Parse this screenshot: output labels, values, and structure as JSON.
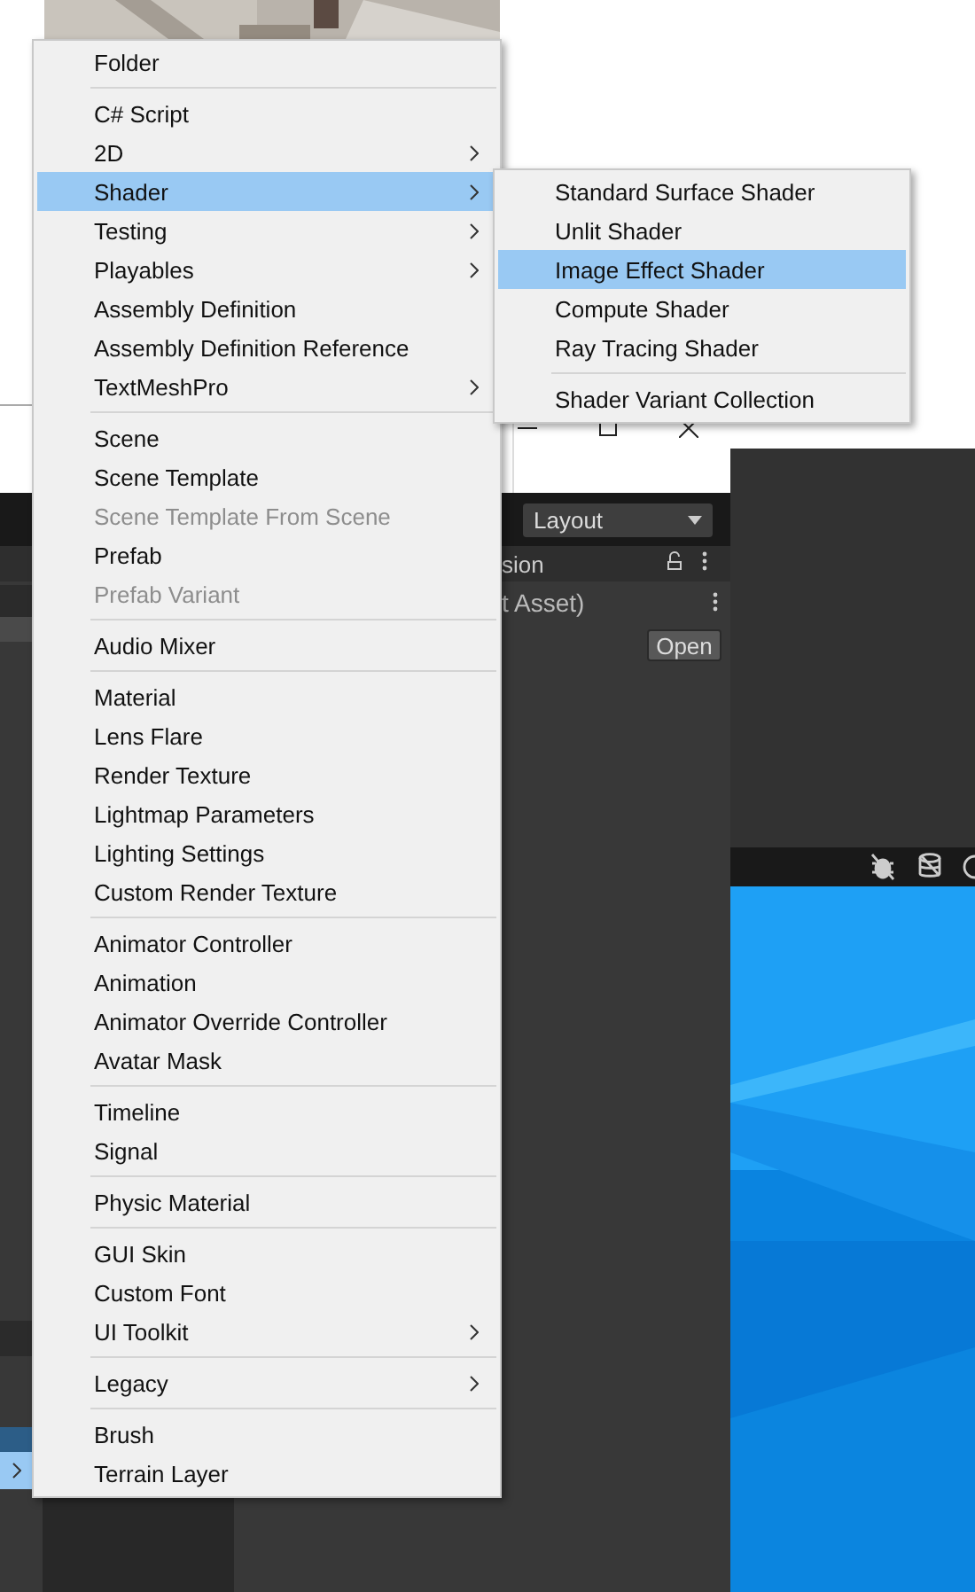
{
  "editor": {
    "layout_dropdown": {
      "label": "Layout"
    },
    "inspector": {
      "title": "sion",
      "asset_name": "t Asset)",
      "open_button": "Open"
    }
  },
  "menu": {
    "items": [
      {
        "kind": "item",
        "label": "Folder",
        "submenu": false,
        "disabled": false,
        "selected": false
      },
      {
        "kind": "separator"
      },
      {
        "kind": "item",
        "label": "C# Script",
        "submenu": false,
        "disabled": false,
        "selected": false
      },
      {
        "kind": "item",
        "label": "2D",
        "submenu": true,
        "disabled": false,
        "selected": false
      },
      {
        "kind": "item",
        "label": "Shader",
        "submenu": true,
        "disabled": false,
        "selected": true
      },
      {
        "kind": "item",
        "label": "Testing",
        "submenu": true,
        "disabled": false,
        "selected": false
      },
      {
        "kind": "item",
        "label": "Playables",
        "submenu": true,
        "disabled": false,
        "selected": false
      },
      {
        "kind": "item",
        "label": "Assembly Definition",
        "submenu": false,
        "disabled": false,
        "selected": false
      },
      {
        "kind": "item",
        "label": "Assembly Definition Reference",
        "submenu": false,
        "disabled": false,
        "selected": false
      },
      {
        "kind": "item",
        "label": "TextMeshPro",
        "submenu": true,
        "disabled": false,
        "selected": false
      },
      {
        "kind": "separator"
      },
      {
        "kind": "item",
        "label": "Scene",
        "submenu": false,
        "disabled": false,
        "selected": false
      },
      {
        "kind": "item",
        "label": "Scene Template",
        "submenu": false,
        "disabled": false,
        "selected": false
      },
      {
        "kind": "item",
        "label": "Scene Template From Scene",
        "submenu": false,
        "disabled": true,
        "selected": false
      },
      {
        "kind": "item",
        "label": "Prefab",
        "submenu": false,
        "disabled": false,
        "selected": false
      },
      {
        "kind": "item",
        "label": "Prefab Variant",
        "submenu": false,
        "disabled": true,
        "selected": false
      },
      {
        "kind": "separator"
      },
      {
        "kind": "item",
        "label": "Audio Mixer",
        "submenu": false,
        "disabled": false,
        "selected": false
      },
      {
        "kind": "separator"
      },
      {
        "kind": "item",
        "label": "Material",
        "submenu": false,
        "disabled": false,
        "selected": false
      },
      {
        "kind": "item",
        "label": "Lens Flare",
        "submenu": false,
        "disabled": false,
        "selected": false
      },
      {
        "kind": "item",
        "label": "Render Texture",
        "submenu": false,
        "disabled": false,
        "selected": false
      },
      {
        "kind": "item",
        "label": "Lightmap Parameters",
        "submenu": false,
        "disabled": false,
        "selected": false
      },
      {
        "kind": "item",
        "label": "Lighting Settings",
        "submenu": false,
        "disabled": false,
        "selected": false
      },
      {
        "kind": "item",
        "label": "Custom Render Texture",
        "submenu": false,
        "disabled": false,
        "selected": false
      },
      {
        "kind": "separator"
      },
      {
        "kind": "item",
        "label": "Animator Controller",
        "submenu": false,
        "disabled": false,
        "selected": false
      },
      {
        "kind": "item",
        "label": "Animation",
        "submenu": false,
        "disabled": false,
        "selected": false
      },
      {
        "kind": "item",
        "label": "Animator Override Controller",
        "submenu": false,
        "disabled": false,
        "selected": false
      },
      {
        "kind": "item",
        "label": "Avatar Mask",
        "submenu": false,
        "disabled": false,
        "selected": false
      },
      {
        "kind": "separator"
      },
      {
        "kind": "item",
        "label": "Timeline",
        "submenu": false,
        "disabled": false,
        "selected": false
      },
      {
        "kind": "item",
        "label": "Signal",
        "submenu": false,
        "disabled": false,
        "selected": false
      },
      {
        "kind": "separator"
      },
      {
        "kind": "item",
        "label": "Physic Material",
        "submenu": false,
        "disabled": false,
        "selected": false
      },
      {
        "kind": "separator"
      },
      {
        "kind": "item",
        "label": "GUI Skin",
        "submenu": false,
        "disabled": false,
        "selected": false
      },
      {
        "kind": "item",
        "label": "Custom Font",
        "submenu": false,
        "disabled": false,
        "selected": false
      },
      {
        "kind": "item",
        "label": "UI Toolkit",
        "submenu": true,
        "disabled": false,
        "selected": false
      },
      {
        "kind": "separator"
      },
      {
        "kind": "item",
        "label": "Legacy",
        "submenu": true,
        "disabled": false,
        "selected": false
      },
      {
        "kind": "separator"
      },
      {
        "kind": "item",
        "label": "Brush",
        "submenu": false,
        "disabled": false,
        "selected": false
      },
      {
        "kind": "item",
        "label": "Terrain Layer",
        "submenu": false,
        "disabled": false,
        "selected": false
      }
    ]
  },
  "submenu": {
    "items": [
      {
        "kind": "item",
        "label": "Standard Surface Shader",
        "submenu": false,
        "disabled": false,
        "selected": false
      },
      {
        "kind": "item",
        "label": "Unlit Shader",
        "submenu": false,
        "disabled": false,
        "selected": false
      },
      {
        "kind": "item",
        "label": "Image Effect Shader",
        "submenu": false,
        "disabled": false,
        "selected": true
      },
      {
        "kind": "item",
        "label": "Compute Shader",
        "submenu": false,
        "disabled": false,
        "selected": false
      },
      {
        "kind": "item",
        "label": "Ray Tracing Shader",
        "submenu": false,
        "disabled": false,
        "selected": false
      },
      {
        "kind": "separator"
      },
      {
        "kind": "item",
        "label": "Shader Variant Collection",
        "submenu": false,
        "disabled": false,
        "selected": false
      }
    ]
  }
}
